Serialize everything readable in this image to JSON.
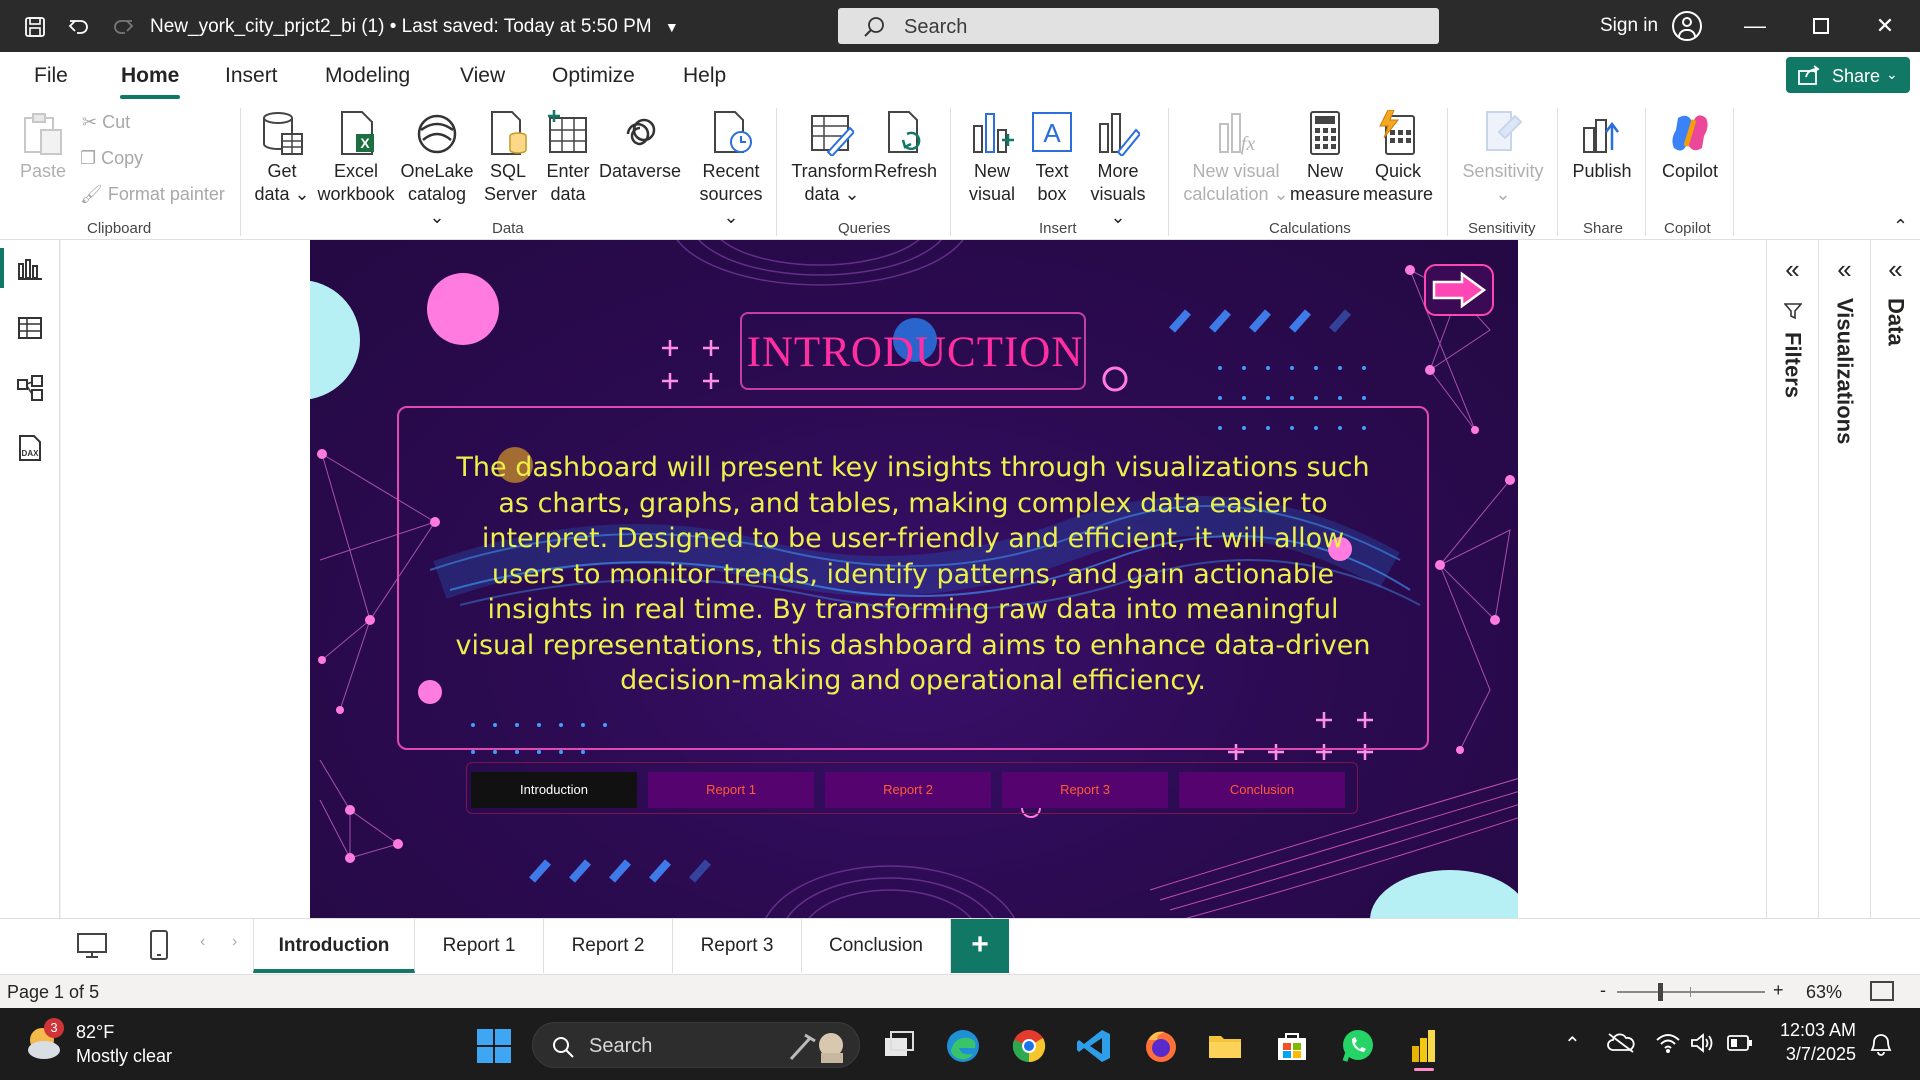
{
  "window": {
    "title": "New_york_city_prjct2_bi (1)  •  Last saved: Today at 5:50 PM",
    "search_label": "Search",
    "signin_label": "Sign in"
  },
  "menu": {
    "tabs": [
      "File",
      "Home",
      "Insert",
      "Modeling",
      "View",
      "Optimize",
      "Help"
    ],
    "active": "Home",
    "share_label": "Share"
  },
  "ribbon": {
    "clipboard": {
      "paste": "Paste",
      "cut": "Cut",
      "copy": "Copy",
      "format_painter": "Format painter",
      "group": "Clipboard"
    },
    "data": {
      "get_data": [
        "Get",
        "data ⌄"
      ],
      "excel": [
        "Excel",
        "workbook"
      ],
      "onelake": [
        "OneLake",
        "catalog ⌄"
      ],
      "sql": [
        "SQL",
        "Server"
      ],
      "enter": [
        "Enter",
        "data"
      ],
      "dataverse": [
        "Dataverse",
        ""
      ],
      "recent": [
        "Recent",
        "sources ⌄"
      ],
      "group": "Data"
    },
    "queries": {
      "transform": [
        "Transform",
        "data ⌄"
      ],
      "refresh": [
        "Refresh",
        ""
      ],
      "group": "Queries"
    },
    "insert": {
      "new_visual": [
        "New",
        "visual"
      ],
      "text_box": [
        "Text",
        "box"
      ],
      "more_visuals": [
        "More",
        "visuals ⌄"
      ],
      "group": "Insert"
    },
    "calculations": {
      "new_visual_calc": [
        "New visual",
        "calculation ⌄"
      ],
      "new_measure": [
        "New",
        "measure"
      ],
      "quick_measure": [
        "Quick",
        "measure"
      ],
      "group": "Calculations"
    },
    "sensitivity": {
      "label": [
        "Sensitivity",
        "⌄"
      ],
      "group": "Sensitivity"
    },
    "share": {
      "publish": [
        "Publish",
        ""
      ],
      "group": "Share"
    },
    "copilot": {
      "label": [
        "Copilot",
        ""
      ],
      "group": "Copilot"
    }
  },
  "report": {
    "title": "INTRODUCTION",
    "body": "The dashboard will present key insights through visualizations such as charts, graphs, and tables, making complex data easier to interpret. Designed to be user-friendly and efficient, it will allow users to monitor trends, identify patterns, and gain actionable insights in real time. By transforming raw data into meaningful visual representations, this dashboard aims to enhance data-driven decision-making and operational efficiency.",
    "nav_buttons": [
      "Introduction",
      "Report 1",
      "Report 2",
      "Report 3",
      "Conclusion"
    ],
    "active_nav": "Introduction",
    "colors": {
      "title": "#ff2ea1",
      "body_text": "#ecf04a",
      "nav_active": "#111111",
      "nav_inactive": "#55046f"
    }
  },
  "panes": {
    "filters": "Filters",
    "visualizations": "Visualizations",
    "data": "Data"
  },
  "page_tabs": {
    "tabs": [
      "Introduction",
      "Report 1",
      "Report 2",
      "Report 3",
      "Conclusion"
    ],
    "active": "Introduction",
    "add_label": "+"
  },
  "status": {
    "page_info": "Page 1 of 5",
    "zoom": "63%",
    "zoom_minus": "-",
    "zoom_plus": "+"
  },
  "taskbar": {
    "weather_temp": "82°F",
    "weather_desc": "Mostly clear",
    "weather_badge": "3",
    "search_label": "Search",
    "time": "12:03 AM",
    "date": "3/7/2025"
  },
  "accent_color": "#117865"
}
